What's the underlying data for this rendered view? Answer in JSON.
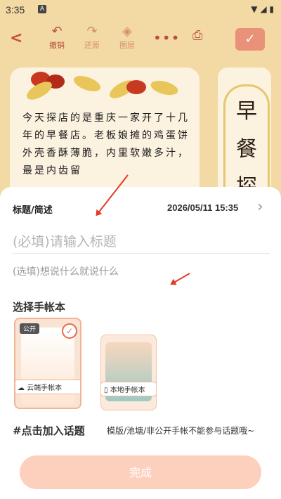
{
  "status_bar": {
    "time": "3:35",
    "notice_icon": "A"
  },
  "toolbar": {
    "back_icon": "chevron-left-icon",
    "undo_label": "撤销",
    "redo_label": "还原",
    "layers_label": "图层",
    "more_icon": "dots-icon",
    "print_icon": "print-icon",
    "confirm_icon": "checkmark-icon"
  },
  "journal": {
    "text": "今天探店的是重庆一家开了十几年的早餐店。老板娘摊的鸡蛋饼外壳香酥薄脆，内里软嫩多汁，最是内齿留",
    "title_chars": [
      "早",
      "餐",
      "探"
    ]
  },
  "sheet": {
    "header_label": "标题/简述",
    "date": "2026/05/11 15:35",
    "title_placeholder": "(必填)请输入标题",
    "desc_placeholder": "(选填)想说什么就说什么",
    "section_title": "选择手帐本",
    "notebooks": [
      {
        "label": "云端手帐本",
        "badge": "公开",
        "selected": true
      },
      {
        "label": "本地手帐本",
        "selected": false
      }
    ],
    "topic_label": "#点击加入话题",
    "topic_note": "模版/池塘/非公开手帐不能参与话题哦~",
    "done_label": "完成"
  },
  "colors": {
    "accent": "#e7694f",
    "toolbar_icon": "#b8513c",
    "done_bg": "#fdd0bd"
  }
}
